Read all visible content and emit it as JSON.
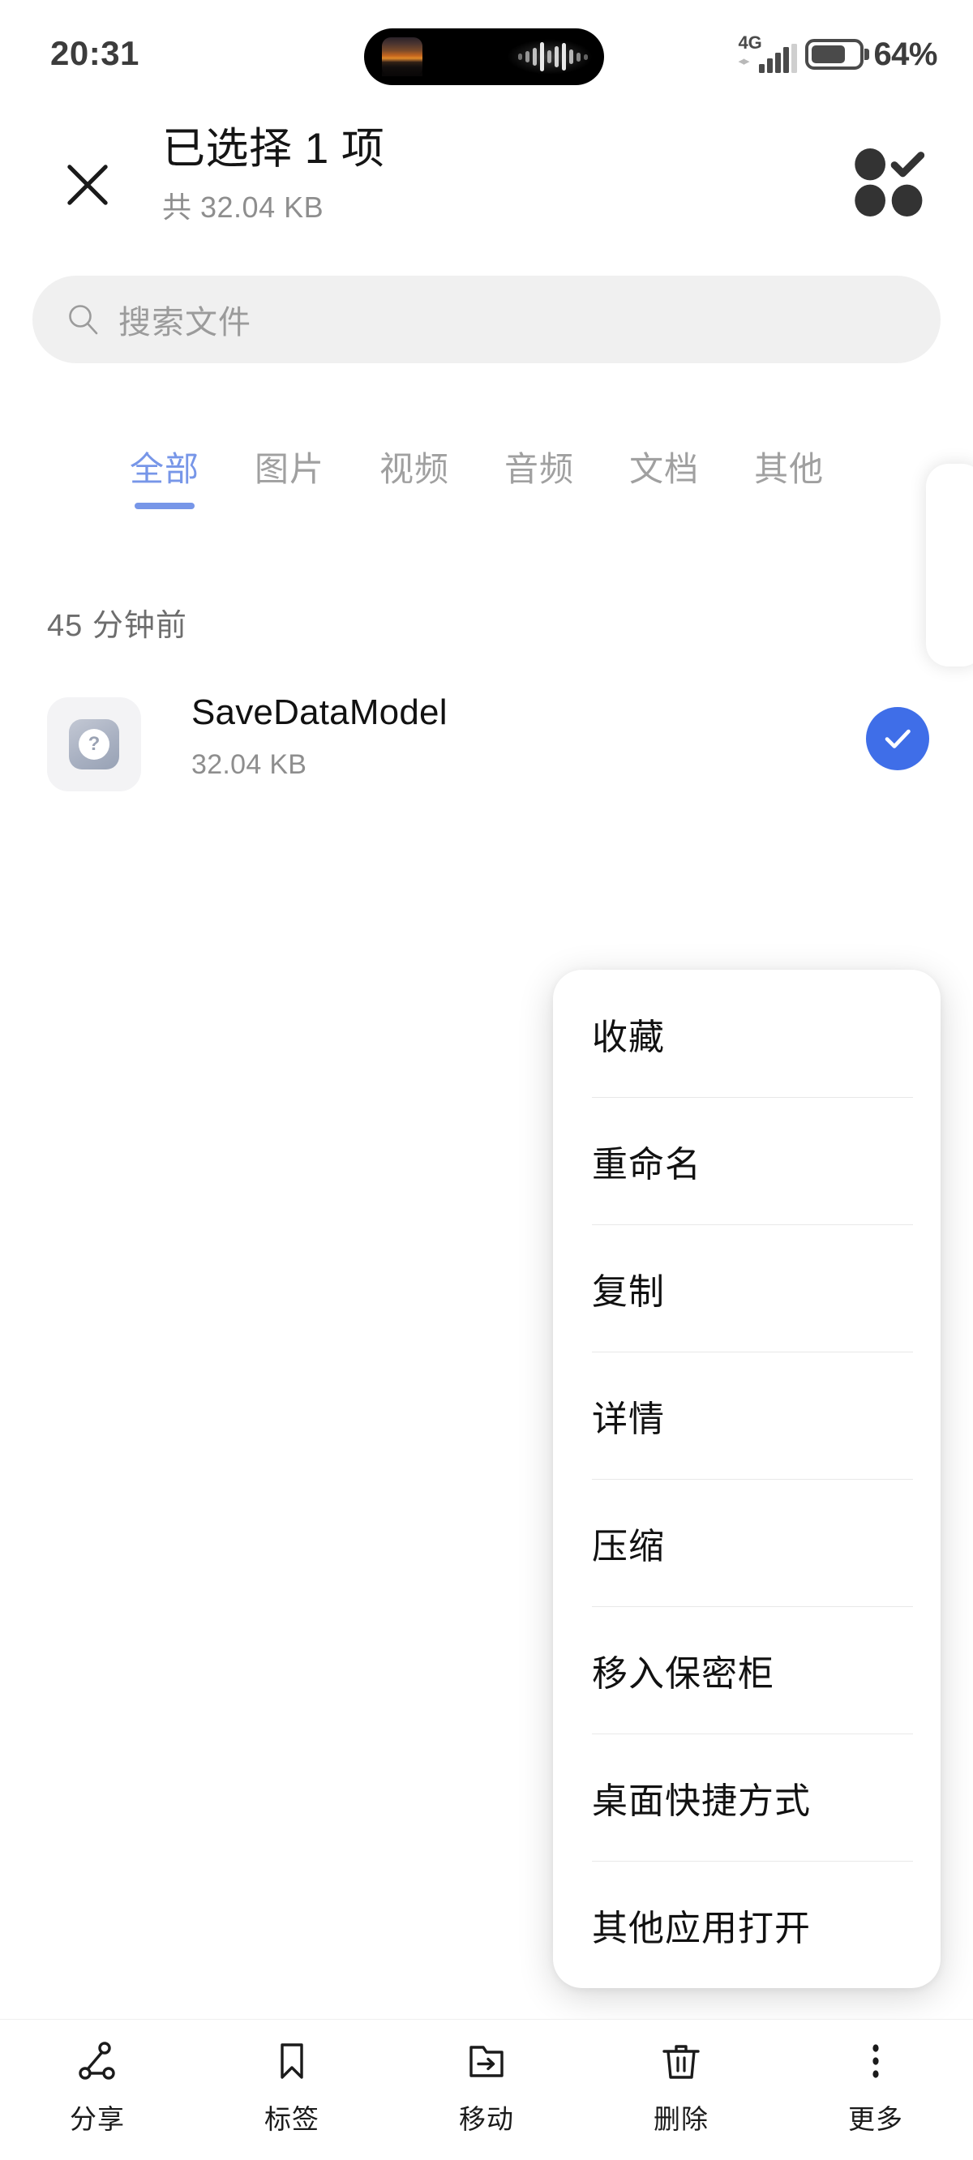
{
  "status_bar": {
    "time": "20:31",
    "network_type": "4G",
    "battery_percent": "64%",
    "battery_level": 64,
    "dynamic_island": {
      "album_art": "sunset-thumbnail",
      "visualizer": "audio-waveform"
    }
  },
  "header": {
    "close_icon": "close-icon",
    "title": "已选择 1 项",
    "subtitle": "共 32.04 KB",
    "select_all_icon": "select-all-icon"
  },
  "search": {
    "icon": "search-icon",
    "placeholder": "搜索文件",
    "value": ""
  },
  "tabs": {
    "active_index": 0,
    "items": [
      {
        "label": "全部"
      },
      {
        "label": "图片"
      },
      {
        "label": "视频"
      },
      {
        "label": "音频"
      },
      {
        "label": "文档"
      },
      {
        "label": "其他"
      }
    ]
  },
  "file_list": {
    "date_header": "45 分钟前",
    "files": [
      {
        "name": "SaveDataModel",
        "size": "32.04 KB",
        "icon": "unknown-file-icon",
        "selected": true
      }
    ]
  },
  "context_menu": {
    "items": [
      {
        "label": "收藏"
      },
      {
        "label": "重命名"
      },
      {
        "label": "复制"
      },
      {
        "label": "详情"
      },
      {
        "label": "压缩"
      },
      {
        "label": "移入保密柜"
      },
      {
        "label": "桌面快捷方式"
      },
      {
        "label": "其他应用打开"
      }
    ]
  },
  "bottom_bar": {
    "items": [
      {
        "label": "分享",
        "icon": "share-icon"
      },
      {
        "label": "标签",
        "icon": "bookmark-icon"
      },
      {
        "label": "移动",
        "icon": "folder-move-icon"
      },
      {
        "label": "删除",
        "icon": "trash-icon"
      },
      {
        "label": "更多",
        "icon": "more-vertical-icon"
      }
    ]
  },
  "colors": {
    "accent_blue": "#3f6ee8",
    "tab_active": "#7796e8",
    "search_bg": "#f0f0f0",
    "text_primary": "#111111",
    "text_secondary": "#8e8e8e"
  }
}
